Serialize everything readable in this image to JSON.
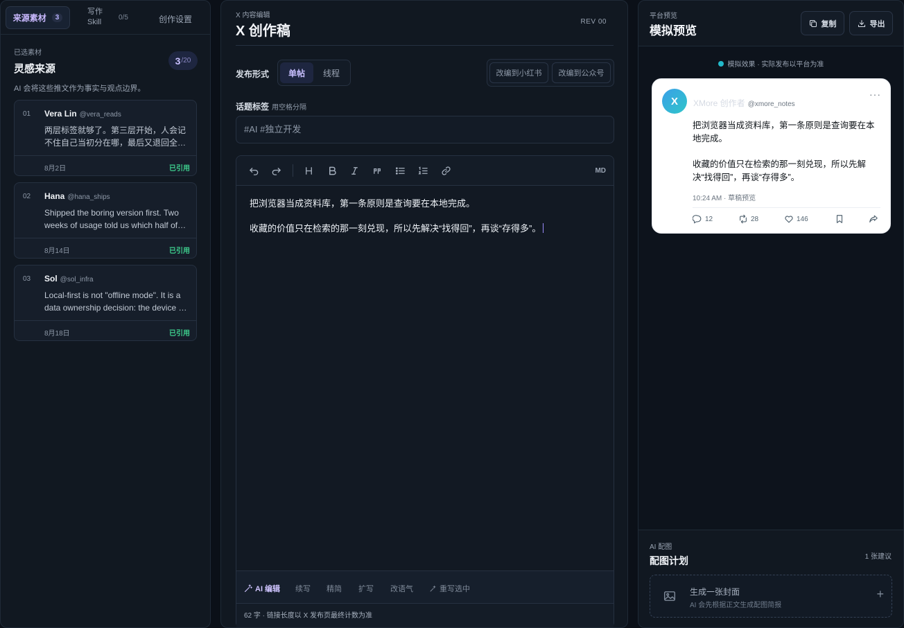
{
  "left": {
    "tabs": {
      "sources_label": "来源素材",
      "sources_count": "3",
      "skill_line1": "写作",
      "skill_line2": "Skill",
      "skill_count": "0/5",
      "settings_label": "创作设置"
    },
    "eyebrow": "已选素材",
    "title": "灵感来源",
    "counter_value": "3",
    "counter_total": "/20",
    "description": "AI 会将这些推文作为事实与观点边界。",
    "cards": [
      {
        "num": "01",
        "author": "Vera Lin",
        "handle": "@vera_reads",
        "text": "两层标签就够了。第三层开始，人会记不住自己当初分在哪，最后又退回全文搜索。",
        "date": "8月2日",
        "status": "已引用"
      },
      {
        "num": "02",
        "author": "Hana",
        "handle": "@hana_ships",
        "text": "Shipped the boring version first. Two weeks of usage told us which half of the roadmap was fiction.",
        "date": "8月14日",
        "status": "已引用"
      },
      {
        "num": "03",
        "author": "Sol",
        "handle": "@sol_infra",
        "text": "Local-first is not \"offline mode\". It is a data ownership decision: the device is the source of truth.",
        "date": "8月18日",
        "status": "已引用"
      }
    ]
  },
  "center": {
    "eyebrow": "X 内容编辑",
    "title": "X 创作稿",
    "rev": "REV 00",
    "format_label": "发布形式",
    "format_single": "单帖",
    "format_thread": "线程",
    "adapt_xhs": "改编到小红书",
    "adapt_wechat": "改编到公众号",
    "tags_label": "话题标签",
    "tags_hint": "用空格分隔",
    "tags_value": "#AI #独立开发",
    "toolbar_md": "MD",
    "body_p1": "把浏览器当成资料库，第一条原则是查询要在本地完成。",
    "body_p2": "收藏的价值只在检索的那一刻兑现，所以先解决“找得回”，再谈“存得多”。",
    "ai_edit": "AI 编辑",
    "ai_continue": "续写",
    "ai_condense": "精简",
    "ai_expand": "扩写",
    "ai_tone": "改语气",
    "ai_rewrite": "重写选中",
    "status": "62 字 · 链接长度以 X 发布页最终计数为准"
  },
  "right": {
    "eyebrow": "平台预览",
    "title": "模拟预览",
    "copy_label": "复制",
    "export_label": "导出",
    "notice": "模拟效果 · 实际发布以平台为准",
    "tweet": {
      "avatar_letter": "X",
      "name": "XMore 创作者",
      "handle": "@xmore_notes",
      "more": "···",
      "p1": "把浏览器当成资料库，第一条原则是查询要在本地完成。",
      "p2": "收藏的价值只在检索的那一刻兑现，所以先解决“找得回”，再谈“存得多”。",
      "meta": "10:24 AM · 草稿预览",
      "replies": "12",
      "retweets": "28",
      "likes": "146"
    },
    "plan": {
      "eyebrow": "AI 配图",
      "title": "配图计划",
      "count": "1 张建议",
      "cover_title": "生成一张封面",
      "cover_sub": "AI 会先根据正文生成配图简报",
      "plus": "+"
    }
  },
  "colors": {
    "accent": "#c9c0ff",
    "success": "#3ecf8e",
    "teal": "#22b8c9"
  }
}
